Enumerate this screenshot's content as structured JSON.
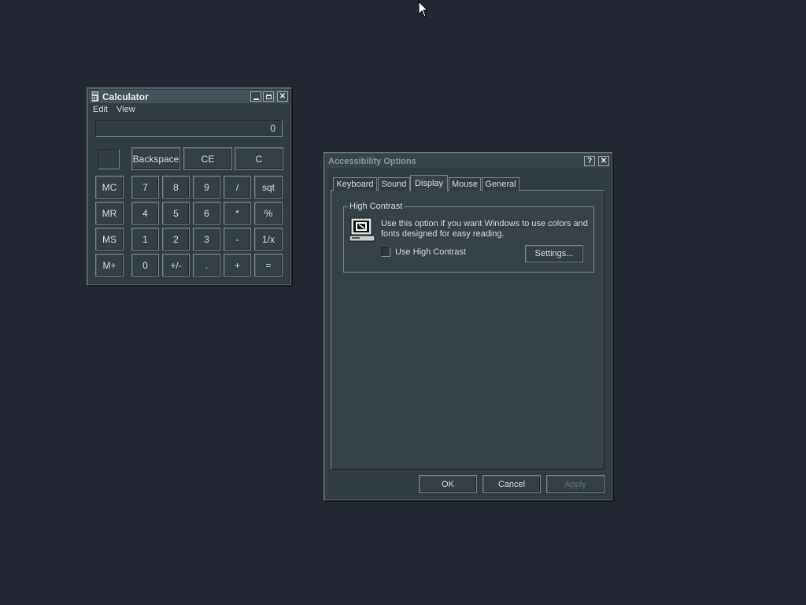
{
  "calculator": {
    "title": "Calculator",
    "menu": [
      "Edit",
      "View"
    ],
    "display_value": "0",
    "top_buttons": [
      "Backspace",
      "CE",
      "C"
    ],
    "memory_buttons": [
      "MC",
      "MR",
      "MS",
      "M+"
    ],
    "keypad_rows": [
      [
        "7",
        "8",
        "9",
        "/",
        "sqt"
      ],
      [
        "4",
        "5",
        "6",
        "*",
        "%"
      ],
      [
        "1",
        "2",
        "3",
        "-",
        "1/x"
      ],
      [
        "0",
        "+/-",
        ".",
        "+",
        "="
      ]
    ]
  },
  "accessibility": {
    "title": "Accessibility Options",
    "title_buttons": [
      "?",
      "✕"
    ],
    "tabs": [
      "Keyboard",
      "Sound",
      "Display",
      "Mouse",
      "General"
    ],
    "selected_tab": "Display",
    "group_label": "High Contrast",
    "description_line1": "Use this option if you want Windows to use colors and",
    "description_line2": "fonts designed for easy reading.",
    "checkbox_label": "Use High Contrast",
    "checkbox_checked": false,
    "settings_button": "Settings...",
    "footer_buttons": {
      "ok": "OK",
      "cancel": "Cancel",
      "apply": "Apply"
    }
  }
}
